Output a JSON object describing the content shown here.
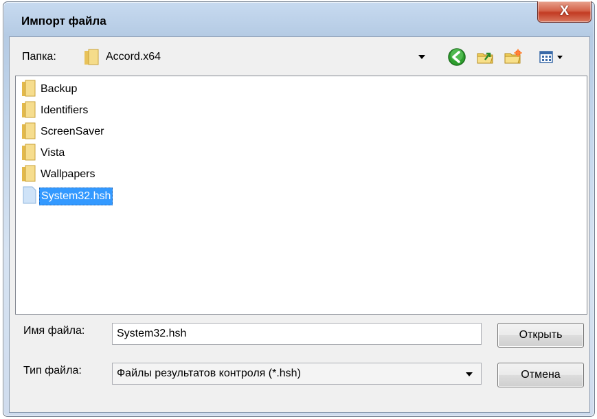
{
  "window": {
    "title": "Импорт файла",
    "close_glyph": "X"
  },
  "folder": {
    "label": "Папка:",
    "current": "Accord.x64"
  },
  "toolbar": {
    "back_icon": "back-arrow-icon",
    "up_icon": "folder-up-icon",
    "new_folder_icon": "new-folder-icon",
    "view_icon": "view-menu-icon"
  },
  "files": [
    {
      "name": "Backup",
      "type": "folder"
    },
    {
      "name": "Identifiers",
      "type": "folder"
    },
    {
      "name": "ScreenSaver",
      "type": "folder"
    },
    {
      "name": "Vista",
      "type": "folder"
    },
    {
      "name": "Wallpapers",
      "type": "folder"
    },
    {
      "name": "System32.hsh",
      "type": "file",
      "selected": true
    }
  ],
  "filename": {
    "label": "Имя файла:",
    "value": "System32.hsh"
  },
  "filetype": {
    "label": "Тип файла:",
    "value": "Файлы результатов контроля (*.hsh)"
  },
  "buttons": {
    "open": "Открыть",
    "cancel": "Отмена"
  },
  "colors": {
    "selection": "#3399ff",
    "close": "#c23a22",
    "frame": "#c3d6ec"
  }
}
